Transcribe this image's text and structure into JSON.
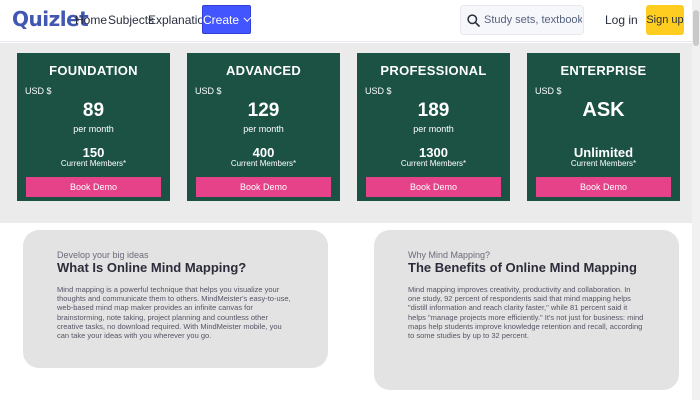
{
  "nav": {
    "logo": "Quizlet",
    "links": [
      "Home",
      "Subjects",
      "Explanations"
    ],
    "create_label": "Create",
    "search_placeholder": "Study sets, textbooks, ...",
    "login_label": "Log in",
    "signup_label": "Sign up"
  },
  "plans": [
    {
      "name": "FOUNDATION",
      "currency": "USD $",
      "price": "89",
      "period": "per month",
      "members": "150",
      "members_label": "Current Members*",
      "cta": "Book Demo"
    },
    {
      "name": "ADVANCED",
      "currency": "USD $",
      "price": "129",
      "period": "per month",
      "members": "400",
      "members_label": "Current Members*",
      "cta": "Book Demo"
    },
    {
      "name": "PROFESSIONAL",
      "currency": "USD $",
      "price": "189",
      "period": "per month",
      "members": "1300",
      "members_label": "Current Members*",
      "cta": "Book Demo"
    },
    {
      "name": "ENTERPRISE",
      "currency": "USD $",
      "price": "ASK",
      "period": "",
      "members": "Unlimited",
      "members_label": "Current Members*",
      "cta": "Book Demo"
    }
  ],
  "cards": [
    {
      "eyebrow": "Develop your big ideas",
      "title": "What Is Online Mind Mapping?",
      "body": "Mind mapping is a powerful technique that helps you visualize your thoughts and communicate them to others. MindMeister's easy-to-use, web-based mind map maker provides an infinite canvas for brainstorming, note taking, project planning and countless other creative tasks, no download required. With MindMeister mobile, you can take your ideas with you wherever you go."
    },
    {
      "eyebrow": "Why Mind Mapping?",
      "title": "The Benefits of Online Mind Mapping",
      "body": "Mind mapping improves creativity, productivity and collaboration. In one study, 92 percent of respondents said that mind mapping helps \"distill information and reach clarity faster,\" while 81 percent said it helps \"manage projects more efficiently.\" It's not just for business: mind maps help students improve knowledge retention and recall, according to some studies by up to 32 percent."
    }
  ],
  "colors": {
    "brand": "#4257b2",
    "create_button": "#4255ff",
    "signup_button": "#ffcd1f",
    "plan_card": "#1c5244",
    "book_demo": "#e6428a",
    "info_card": "#e3e3e3"
  },
  "icons": {
    "search": "search-icon",
    "create_chevron": "chevron-down-icon"
  }
}
